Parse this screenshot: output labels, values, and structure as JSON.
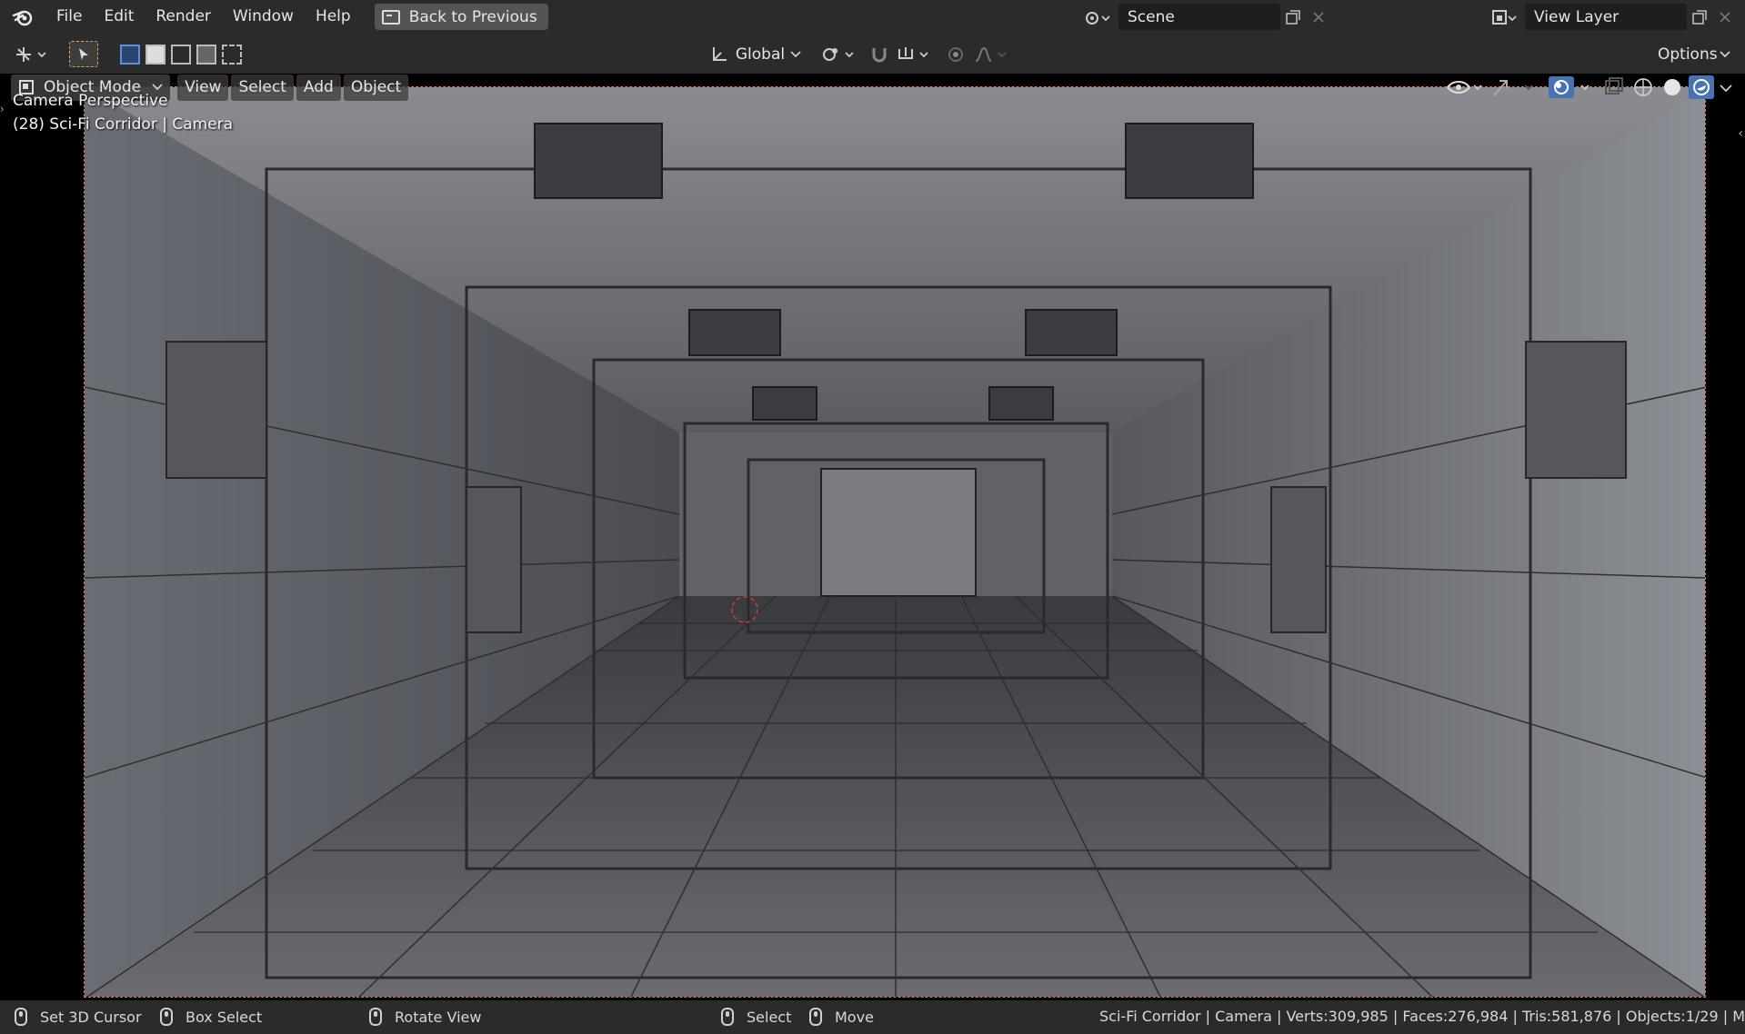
{
  "app": {
    "logo_icon": "blender-logo-icon",
    "menus": [
      "File",
      "Edit",
      "Render",
      "Window",
      "Help"
    ],
    "back_button": "Back to Previous"
  },
  "scene": {
    "icon": "scene-icon",
    "name": "Scene"
  },
  "view_layer": {
    "icon": "view-layer-icon",
    "name": "View Layer"
  },
  "toolbar": {
    "transform_orientation": "Global",
    "options_label": "Options"
  },
  "viewport_header": {
    "mode": "Object Mode",
    "menus": [
      "View",
      "Select",
      "Add",
      "Object"
    ]
  },
  "viewport": {
    "perspective_label": "Camera Perspective",
    "object_label": "(28) Sci-Fi Corridor | Camera"
  },
  "statusbar": {
    "hints": [
      {
        "label": "Set 3D Cursor",
        "icon": "mouse-left-icon"
      },
      {
        "label": "Box Select",
        "icon": "mouse-drag-icon"
      },
      {
        "label": "Rotate View",
        "icon": "mouse-middle-icon"
      },
      {
        "label": "Select",
        "icon": "mouse-left-icon"
      },
      {
        "label": "Move",
        "icon": "mouse-drag-icon"
      }
    ],
    "stats": "Sci-Fi Corridor | Camera | Verts:309,985 | Faces:276,984 | Tris:581,876 | Objects:1/29 | M"
  },
  "colors": {
    "header_bg": "#2b2b2b",
    "viewport_bg": "#000000",
    "camera_border": "#d47a4e",
    "accent": "#4772b3"
  }
}
